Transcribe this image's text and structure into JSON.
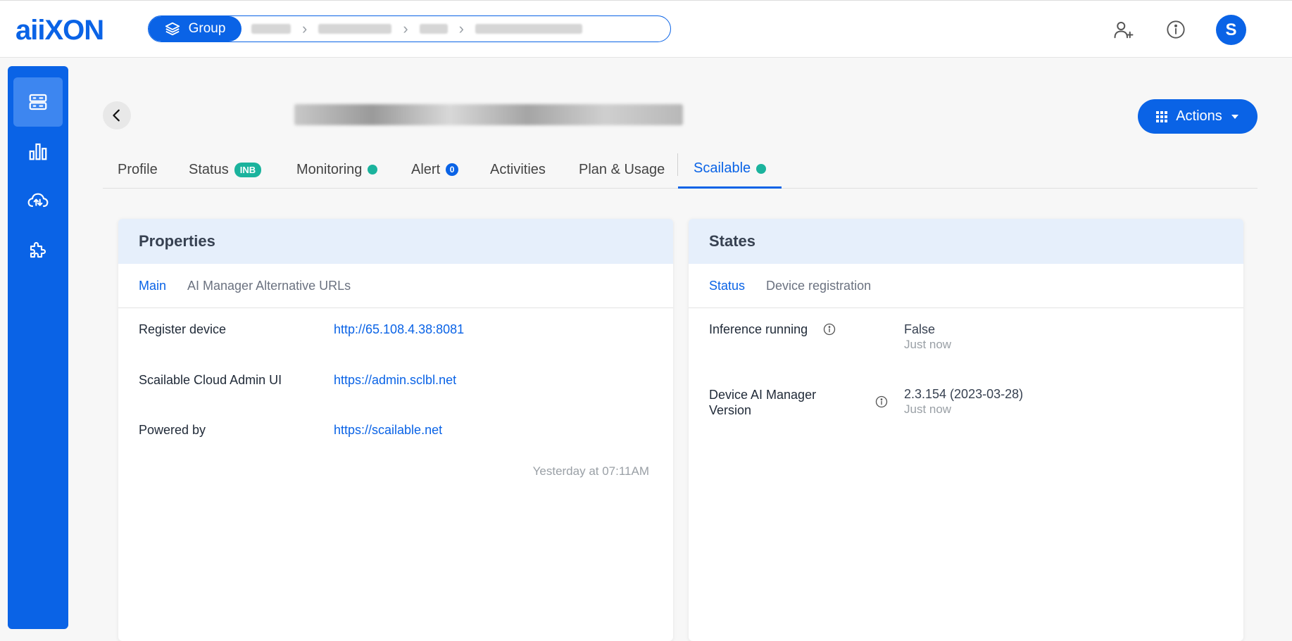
{
  "app": {
    "logo": "aiiXON"
  },
  "breadcrumb": {
    "group_label": "Group"
  },
  "user": {
    "initial": "S"
  },
  "header": {
    "actions_label": "Actions"
  },
  "tabs": {
    "profile": "Profile",
    "status": "Status",
    "status_badge": "INB",
    "monitoring": "Monitoring",
    "alert": "Alert",
    "alert_count": "0",
    "activities": "Activities",
    "plan": "Plan & Usage",
    "scailable": "Scailable"
  },
  "properties": {
    "title": "Properties",
    "subtabs": [
      "Main",
      "AI Manager Alternative URLs"
    ],
    "rows": [
      {
        "label": "Register device",
        "value": "http://65.108.4.38:8081"
      },
      {
        "label": "Scailable Cloud Admin UI",
        "value": "https://admin.sclbl.net"
      },
      {
        "label": "Powered by",
        "value": "https://scailable.net"
      }
    ],
    "updated": "Yesterday at 07:11AM"
  },
  "states": {
    "title": "States",
    "subtabs": [
      "Status",
      "Device registration"
    ],
    "rows": [
      {
        "label": "Inference running",
        "value": "False",
        "time": "Just now"
      },
      {
        "label": "Device AI Manager Version",
        "value": "2.3.154 (2023-03-28)",
        "time": "Just now"
      }
    ]
  },
  "colors": {
    "accent": "#0a63e6",
    "success": "#1bb39d",
    "card_header": "#e6effb"
  }
}
